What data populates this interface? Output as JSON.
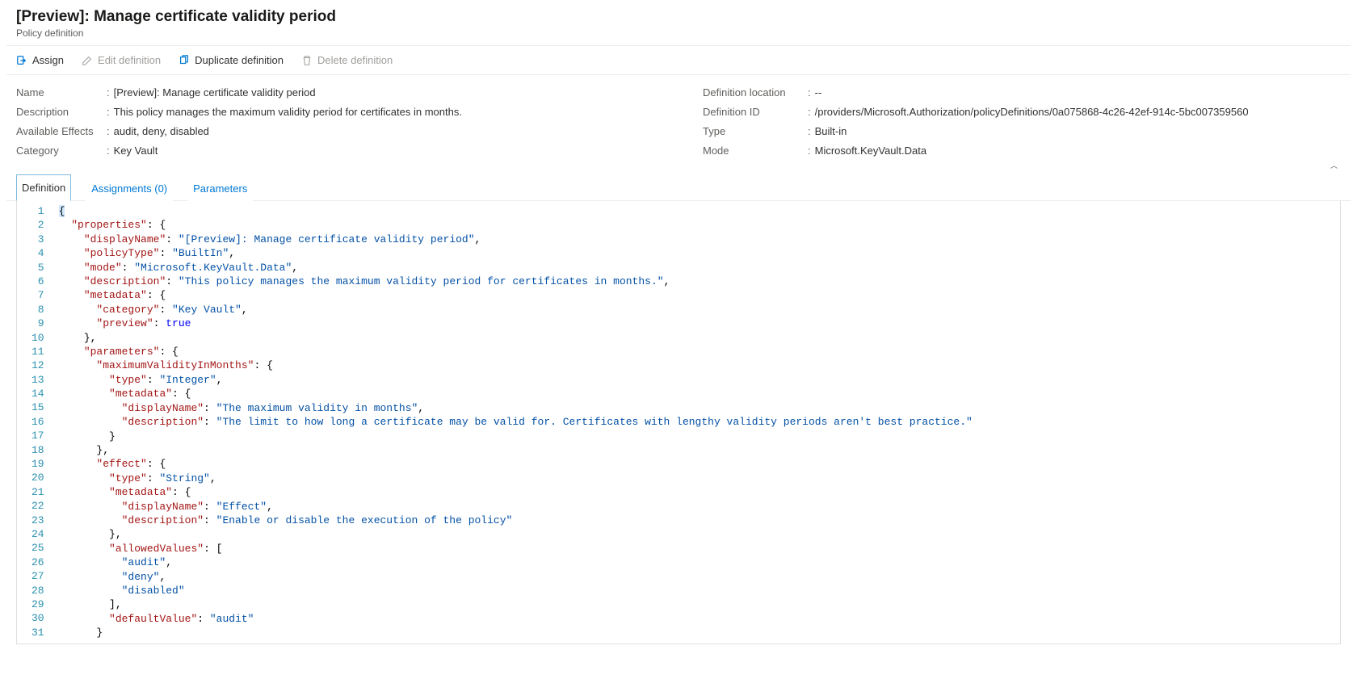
{
  "header": {
    "title": "[Preview]: Manage certificate validity period",
    "subtitle": "Policy definition"
  },
  "toolbar": {
    "assign": "Assign",
    "edit": "Edit definition",
    "duplicate": "Duplicate definition",
    "delete": "Delete definition"
  },
  "essentials": {
    "left": {
      "name_label": "Name",
      "name_value": "[Preview]: Manage certificate validity period",
      "description_label": "Description",
      "description_value": "This policy manages the maximum validity period for certificates in months.",
      "effects_label": "Available Effects",
      "effects_value": "audit, deny, disabled",
      "category_label": "Category",
      "category_value": "Key Vault"
    },
    "right": {
      "location_label": "Definition location",
      "location_value": "--",
      "id_label": "Definition ID",
      "id_value": "/providers/Microsoft.Authorization/policyDefinitions/0a075868-4c26-42ef-914c-5bc007359560",
      "type_label": "Type",
      "type_value": "Built-in",
      "mode_label": "Mode",
      "mode_value": "Microsoft.KeyVault.Data"
    }
  },
  "tabs": {
    "definition": "Definition",
    "assignments": "Assignments (0)",
    "parameters": "Parameters"
  },
  "code_tokens": [
    [
      [
        "p",
        "{"
      ]
    ],
    [
      [
        "p",
        "  "
      ],
      [
        "k",
        "\"properties\""
      ],
      [
        "p",
        ": {"
      ]
    ],
    [
      [
        "p",
        "    "
      ],
      [
        "k",
        "\"displayName\""
      ],
      [
        "p",
        ": "
      ],
      [
        "s",
        "\"[Preview]: Manage certificate validity period\""
      ],
      [
        "p",
        ","
      ]
    ],
    [
      [
        "p",
        "    "
      ],
      [
        "k",
        "\"policyType\""
      ],
      [
        "p",
        ": "
      ],
      [
        "s",
        "\"BuiltIn\""
      ],
      [
        "p",
        ","
      ]
    ],
    [
      [
        "p",
        "    "
      ],
      [
        "k",
        "\"mode\""
      ],
      [
        "p",
        ": "
      ],
      [
        "s",
        "\"Microsoft.KeyVault.Data\""
      ],
      [
        "p",
        ","
      ]
    ],
    [
      [
        "p",
        "    "
      ],
      [
        "k",
        "\"description\""
      ],
      [
        "p",
        ": "
      ],
      [
        "s",
        "\"This policy manages the maximum validity period for certificates in months.\""
      ],
      [
        "p",
        ","
      ]
    ],
    [
      [
        "p",
        "    "
      ],
      [
        "k",
        "\"metadata\""
      ],
      [
        "p",
        ": {"
      ]
    ],
    [
      [
        "p",
        "      "
      ],
      [
        "k",
        "\"category\""
      ],
      [
        "p",
        ": "
      ],
      [
        "s",
        "\"Key Vault\""
      ],
      [
        "p",
        ","
      ]
    ],
    [
      [
        "p",
        "      "
      ],
      [
        "k",
        "\"preview\""
      ],
      [
        "p",
        ": "
      ],
      [
        "b",
        "true"
      ]
    ],
    [
      [
        "p",
        "    },"
      ]
    ],
    [
      [
        "p",
        "    "
      ],
      [
        "k",
        "\"parameters\""
      ],
      [
        "p",
        ": {"
      ]
    ],
    [
      [
        "p",
        "      "
      ],
      [
        "k",
        "\"maximumValidityInMonths\""
      ],
      [
        "p",
        ": {"
      ]
    ],
    [
      [
        "p",
        "        "
      ],
      [
        "k",
        "\"type\""
      ],
      [
        "p",
        ": "
      ],
      [
        "s",
        "\"Integer\""
      ],
      [
        "p",
        ","
      ]
    ],
    [
      [
        "p",
        "        "
      ],
      [
        "k",
        "\"metadata\""
      ],
      [
        "p",
        ": {"
      ]
    ],
    [
      [
        "p",
        "          "
      ],
      [
        "k",
        "\"displayName\""
      ],
      [
        "p",
        ": "
      ],
      [
        "s",
        "\"The maximum validity in months\""
      ],
      [
        "p",
        ","
      ]
    ],
    [
      [
        "p",
        "          "
      ],
      [
        "k",
        "\"description\""
      ],
      [
        "p",
        ": "
      ],
      [
        "s",
        "\"The limit to how long a certificate may be valid for. Certificates with lengthy validity periods aren't best practice.\""
      ]
    ],
    [
      [
        "p",
        "        }"
      ]
    ],
    [
      [
        "p",
        "      },"
      ]
    ],
    [
      [
        "p",
        "      "
      ],
      [
        "k",
        "\"effect\""
      ],
      [
        "p",
        ": {"
      ]
    ],
    [
      [
        "p",
        "        "
      ],
      [
        "k",
        "\"type\""
      ],
      [
        "p",
        ": "
      ],
      [
        "s",
        "\"String\""
      ],
      [
        "p",
        ","
      ]
    ],
    [
      [
        "p",
        "        "
      ],
      [
        "k",
        "\"metadata\""
      ],
      [
        "p",
        ": {"
      ]
    ],
    [
      [
        "p",
        "          "
      ],
      [
        "k",
        "\"displayName\""
      ],
      [
        "p",
        ": "
      ],
      [
        "s",
        "\"Effect\""
      ],
      [
        "p",
        ","
      ]
    ],
    [
      [
        "p",
        "          "
      ],
      [
        "k",
        "\"description\""
      ],
      [
        "p",
        ": "
      ],
      [
        "s",
        "\"Enable or disable the execution of the policy\""
      ]
    ],
    [
      [
        "p",
        "        },"
      ]
    ],
    [
      [
        "p",
        "        "
      ],
      [
        "k",
        "\"allowedValues\""
      ],
      [
        "p",
        ": ["
      ]
    ],
    [
      [
        "p",
        "          "
      ],
      [
        "s",
        "\"audit\""
      ],
      [
        "p",
        ","
      ]
    ],
    [
      [
        "p",
        "          "
      ],
      [
        "s",
        "\"deny\""
      ],
      [
        "p",
        ","
      ]
    ],
    [
      [
        "p",
        "          "
      ],
      [
        "s",
        "\"disabled\""
      ]
    ],
    [
      [
        "p",
        "        ],"
      ]
    ],
    [
      [
        "p",
        "        "
      ],
      [
        "k",
        "\"defaultValue\""
      ],
      [
        "p",
        ": "
      ],
      [
        "s",
        "\"audit\""
      ]
    ],
    [
      [
        "p",
        "      }"
      ]
    ]
  ]
}
